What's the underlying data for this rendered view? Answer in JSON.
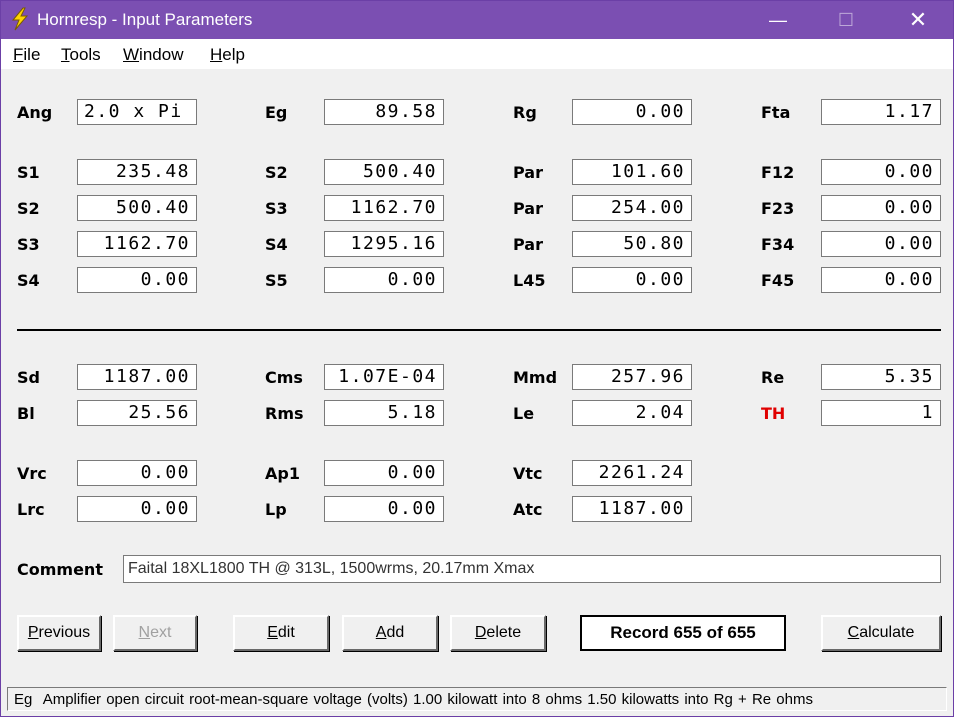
{
  "window": {
    "title": "Hornresp - Input Parameters",
    "minimize": "—",
    "maximize": "☐",
    "close": "✕",
    "accent": "#7b4fb2"
  },
  "menu": [
    {
      "label_u": "F",
      "label_rest": "ile"
    },
    {
      "label_u": "T",
      "label_rest": "ools"
    },
    {
      "label_u": "W",
      "label_rest": "indow"
    },
    {
      "label_u": "H",
      "label_rest": "elp"
    }
  ],
  "params": {
    "ang": {
      "label": "Ang",
      "value": "2.0 x Pi"
    },
    "eg": {
      "label": "Eg",
      "value": "89.58"
    },
    "rg": {
      "label": "Rg",
      "value": "0.00"
    },
    "fta": {
      "label": "Fta",
      "value": "1.17"
    },
    "s1": {
      "label": "S1",
      "value": "235.48"
    },
    "s2a": {
      "label": "S2",
      "value": "500.40"
    },
    "par1": {
      "label": "Par",
      "value": "101.60"
    },
    "f12": {
      "label": "F12",
      "value": "0.00"
    },
    "s2b": {
      "label": "S2",
      "value": "500.40"
    },
    "s3a": {
      "label": "S3",
      "value": "1162.70"
    },
    "par2": {
      "label": "Par",
      "value": "254.00"
    },
    "f23": {
      "label": "F23",
      "value": "0.00"
    },
    "s3b": {
      "label": "S3",
      "value": "1162.70"
    },
    "s4a": {
      "label": "S4",
      "value": "1295.16"
    },
    "par3": {
      "label": "Par",
      "value": "50.80"
    },
    "f34": {
      "label": "F34",
      "value": "0.00"
    },
    "s4b": {
      "label": "S4",
      "value": "0.00"
    },
    "s5": {
      "label": "S5",
      "value": "0.00"
    },
    "l45": {
      "label": "L45",
      "value": "0.00"
    },
    "f45": {
      "label": "F45",
      "value": "0.00"
    },
    "sd": {
      "label": "Sd",
      "value": "1187.00"
    },
    "cms": {
      "label": "Cms",
      "value": "1.07E-04"
    },
    "mmd": {
      "label": "Mmd",
      "value": "257.96"
    },
    "re": {
      "label": "Re",
      "value": "5.35"
    },
    "bl": {
      "label": "Bl",
      "value": "25.56"
    },
    "rms": {
      "label": "Rms",
      "value": "5.18"
    },
    "le": {
      "label": "Le",
      "value": "2.04"
    },
    "th": {
      "label": "TH",
      "value": "1"
    },
    "vrc": {
      "label": "Vrc",
      "value": "0.00"
    },
    "ap1": {
      "label": "Ap1",
      "value": "0.00"
    },
    "vtc": {
      "label": "Vtc",
      "value": "2261.24"
    },
    "lrc": {
      "label": "Lrc",
      "value": "0.00"
    },
    "lp": {
      "label": "Lp",
      "value": "0.00"
    },
    "atc": {
      "label": "Atc",
      "value": "1187.00"
    }
  },
  "comment": {
    "label": "Comment",
    "value": "Faital 18XL1800 TH @ 313L, 1500wrms, 20.17mm Xmax"
  },
  "buttons": {
    "previous": {
      "u": "P",
      "rest": "revious"
    },
    "next": {
      "u": "N",
      "rest": "ext"
    },
    "edit": {
      "u": "E",
      "rest": "dit"
    },
    "add": {
      "u": "A",
      "rest": "dd"
    },
    "delete": {
      "u": "D",
      "rest": "elete"
    },
    "calculate": {
      "u": "C",
      "rest": "alculate"
    }
  },
  "record": "Record 655 of 655",
  "status": {
    "key": "Eg",
    "text": "Amplifier open circuit root-mean-square voltage  (volts)  1.00 kilowatt into 8 ohms   1.50 kilowatts into Rg + Re ohms"
  },
  "colors": {
    "th_label": "#e00000"
  }
}
